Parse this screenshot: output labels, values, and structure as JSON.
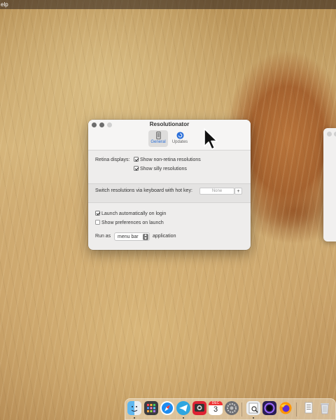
{
  "menubar": {
    "partial_label": "elp"
  },
  "window": {
    "title": "Resolutionator",
    "tabs": [
      {
        "label": "General",
        "icon": "phone-icon",
        "selected": true
      },
      {
        "label": "Updates",
        "icon": "refresh-icon",
        "selected": false
      }
    ],
    "retina": {
      "label": "Retina displays:",
      "options": [
        {
          "label": "Show non-retina resolutions",
          "checked": true
        },
        {
          "label": "Show silly resolutions",
          "checked": true
        }
      ]
    },
    "hotkey": {
      "label": "Switch resolutions via keyboard with hot key:",
      "value": "None",
      "add_label": "+"
    },
    "launch": {
      "options": [
        {
          "label": "Launch automatically on login",
          "checked": true
        },
        {
          "label": "Show preferences on launch",
          "checked": false
        }
      ]
    },
    "run_as": {
      "prefix": "Run as",
      "selected": "menu bar",
      "suffix": "application"
    }
  },
  "dock": {
    "icons": [
      "finder-icon",
      "launchpad-icon",
      "safari-icon",
      "telegram-icon",
      "photo-booth-icon",
      "calendar-icon",
      "system-preferences-icon",
      "preview-icon",
      "screen-recorder-icon",
      "firefox-icon",
      "downloads-icon",
      "trash-icon"
    ],
    "calendar": {
      "month": "DEC",
      "day": "3"
    }
  },
  "colors": {
    "accent": "#2a6fd9",
    "window_bg": "#eeedec"
  }
}
